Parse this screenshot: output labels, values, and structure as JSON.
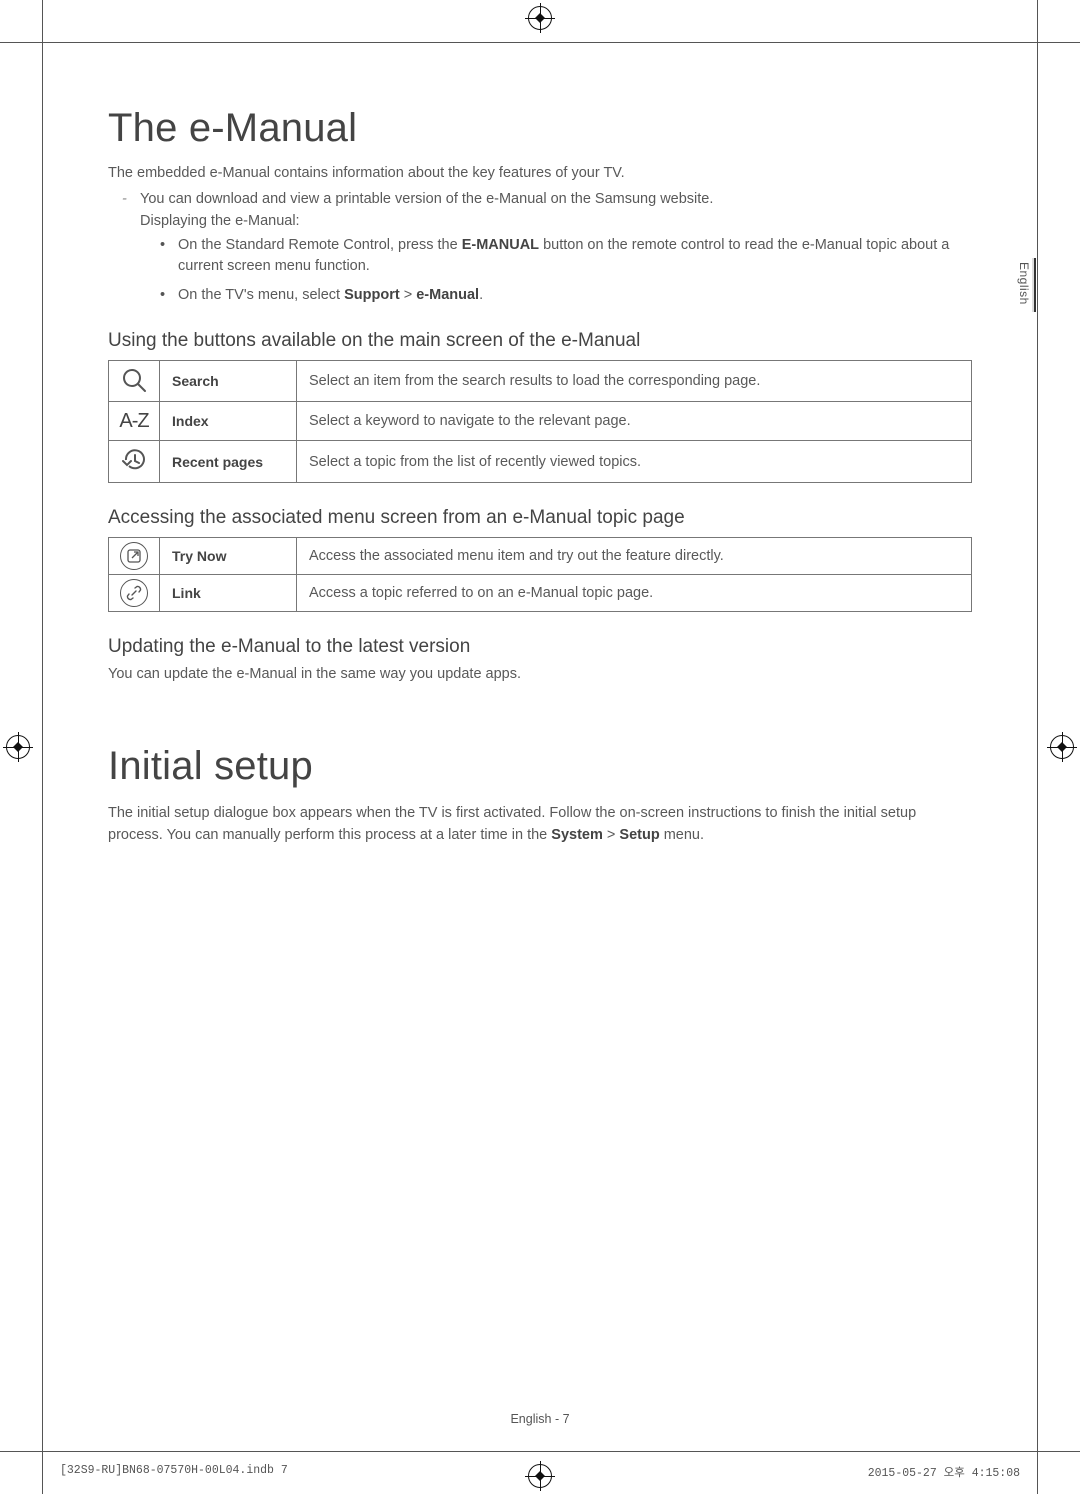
{
  "side_label": "English",
  "section1": {
    "title": "The e-Manual",
    "intro": "The embedded e-Manual contains information about the key features of your TV.",
    "dash": "You can download and view a printable version of the e-Manual on the Samsung website.",
    "sub": "Displaying the e-Manual:",
    "bullets": [
      {
        "pre": "On the Standard Remote Control, press the ",
        "bold": "E-MANUAL",
        "post": " button on the remote control to read the e-Manual topic about a current screen menu function."
      },
      {
        "pre": "On the TV's menu, select ",
        "bold": "Support",
        "mid": " > ",
        "bold2": "e-Manual",
        "post": "."
      }
    ],
    "h2a": "Using the buttons available on the main screen of the e-Manual",
    "table_a": [
      {
        "icon": "search-icon",
        "label": "Search",
        "desc": "Select an item from the search results to load the corresponding page."
      },
      {
        "icon": "index-icon",
        "label": "Index",
        "desc": "Select a keyword to navigate to the relevant page."
      },
      {
        "icon": "recent-icon",
        "label": "Recent pages",
        "desc": "Select a topic from the list of recently viewed topics."
      }
    ],
    "h2b": "Accessing the associated menu screen from an e-Manual topic page",
    "table_b": [
      {
        "icon": "trynow-icon",
        "label": "Try Now",
        "desc": "Access the associated menu item and try out the feature directly."
      },
      {
        "icon": "link-icon",
        "label": "Link",
        "desc": "Access a topic referred to on an e-Manual topic page."
      }
    ],
    "h2c": "Updating the e-Manual to the latest version",
    "update_p": "You can update the e-Manual in the same way you update apps."
  },
  "section2": {
    "title": "Initial setup",
    "p_pre": "The initial setup dialogue box appears when the TV is first activated. Follow the on-screen instructions to finish the initial setup process. You can manually perform this process at a later time in the ",
    "bold1": "System",
    "mid": " > ",
    "bold2": "Setup",
    "p_post": " menu."
  },
  "footer_page": "English - 7",
  "footer_left": "[32S9-RU]BN68-07570H-00L04.indb   7",
  "footer_right": "2015-05-27   오후 4:15:08",
  "index_glyph": "A-Z"
}
